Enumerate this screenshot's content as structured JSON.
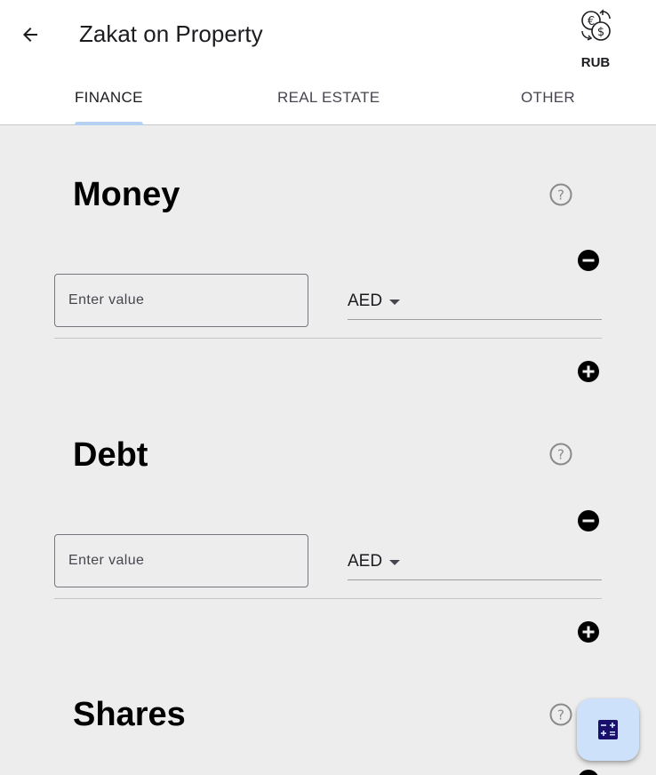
{
  "header": {
    "title": "Zakat on Property",
    "currency_code": "RUB",
    "icons": {
      "back": "arrow-back-icon",
      "currency": "currency-exchange-icon"
    }
  },
  "tabs": [
    {
      "label": "FINANCE",
      "active": true
    },
    {
      "label": "REAL ESTATE",
      "active": false
    },
    {
      "label": "OTHER",
      "active": false
    }
  ],
  "sections": [
    {
      "title": "Money",
      "input_placeholder": "Enter value",
      "input_value": "",
      "currency": "AED"
    },
    {
      "title": "Debt",
      "input_placeholder": "Enter value",
      "input_value": "",
      "currency": "AED"
    },
    {
      "title": "Shares"
    }
  ],
  "fab": {
    "icon": "calculator-icon"
  },
  "colors": {
    "background": "#ededed",
    "appbar": "#ffffff",
    "tab_indicator": "#b5d1f2",
    "fab_background": "#cde1fb",
    "fab_icon": "#1a0f6b"
  }
}
